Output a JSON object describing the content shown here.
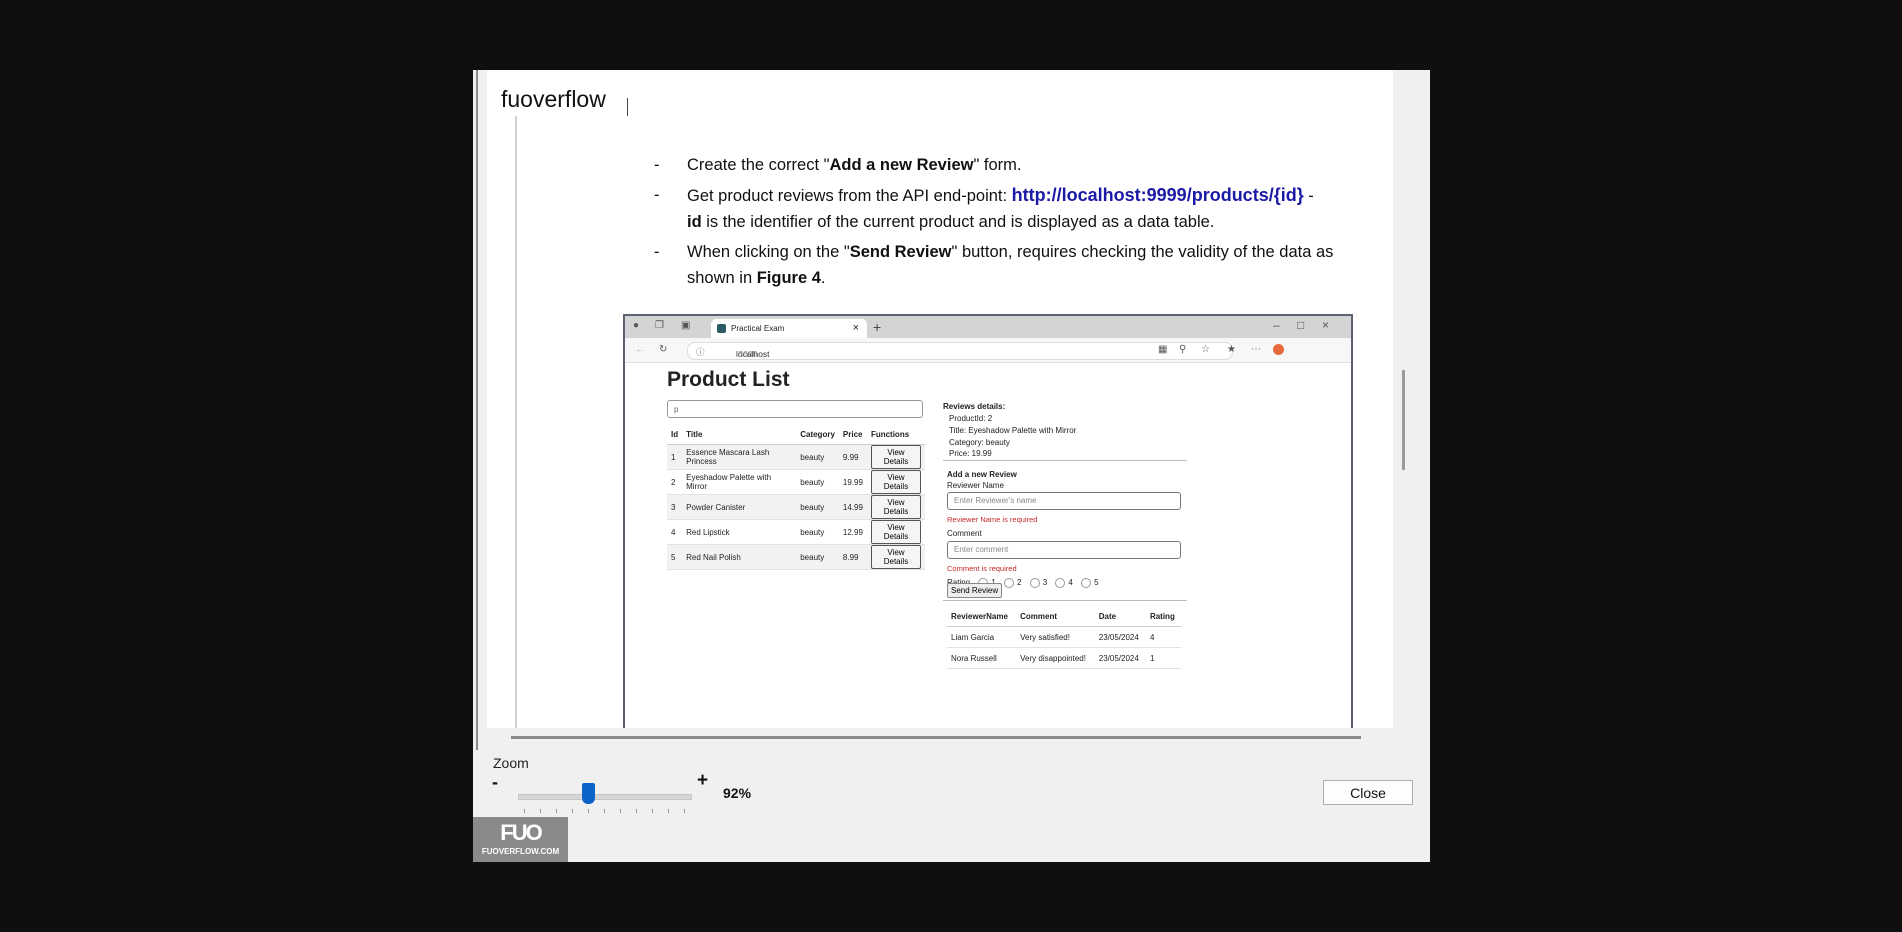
{
  "viewer": {
    "title": "fuoverflow",
    "zoom_label": "Zoom",
    "zoom_minus": "-",
    "zoom_plus": "+",
    "zoom_value": "92%",
    "zoom_level_percent": 92,
    "close_label": "Close",
    "logo_mark": "FUO",
    "logo_site": "FUOVERFLOW.COM"
  },
  "document": {
    "bullets": [
      {
        "dash": "-",
        "pre": "Create the correct \"",
        "bold": "Add a new Review",
        "post": "\" form."
      },
      {
        "dash": "-",
        "pre": "Get product reviews from the API end-point: ",
        "link": "http://localhost:9999/products/{id}",
        "dash2": " -",
        "bold2": "id",
        "post": " is the identifier of the current product and is displayed as a data table."
      },
      {
        "dash": "-",
        "pre": "When clicking on the \"",
        "bold": "Send Review",
        "mid": "\" button, requires checking the validity of the data as shown in ",
        "bold2": "Figure 4",
        "post": "."
      }
    ]
  },
  "figure": {
    "tab_title": "Practical Exam",
    "url_host": "localhost",
    "url_port": ":3000",
    "page_title": "Product List",
    "search_value": "p",
    "product_headers": [
      "Id",
      "Title",
      "Category",
      "Price",
      "Functions"
    ],
    "products": [
      {
        "id": "1",
        "title": "Essence Mascara Lash Princess",
        "category": "beauty",
        "price": "9.99",
        "action": "View Details"
      },
      {
        "id": "2",
        "title": "Eyeshadow Palette with Mirror",
        "category": "beauty",
        "price": "19.99",
        "action": "View Details"
      },
      {
        "id": "3",
        "title": "Powder Canister",
        "category": "beauty",
        "price": "14.99",
        "action": "View Details"
      },
      {
        "id": "4",
        "title": "Red Lipstick",
        "category": "beauty",
        "price": "12.99",
        "action": "View Details"
      },
      {
        "id": "5",
        "title": "Red Nail Polish",
        "category": "beauty",
        "price": "8.99",
        "action": "View Details"
      }
    ],
    "details": {
      "heading": "Reviews details:",
      "product_id": "ProductId: 2",
      "title": "Title: Eyeshadow Palette with Mirror",
      "category": "Category: beauty",
      "price": "Price: 19.99"
    },
    "form": {
      "heading": "Add a new Review",
      "name_label": "Reviewer Name",
      "name_placeholder": "Enter Reviewer's name",
      "name_error": "Reviewer Name is required",
      "comment_label": "Comment",
      "comment_placeholder": "Enter comment",
      "comment_error": "Comment is required",
      "rating_label": "Rating",
      "rating_options": [
        "1",
        "2",
        "3",
        "4",
        "5"
      ],
      "send_label": "Send Review"
    },
    "review_headers": [
      "ReviewerName",
      "Comment",
      "Date",
      "Rating"
    ],
    "reviews": [
      {
        "name": "Liam Garcia",
        "comment": "Very satisfied!",
        "date": "23/05/2024",
        "rating": "4"
      },
      {
        "name": "Nora Russell",
        "comment": "Very disappointed!",
        "date": "23/05/2024",
        "rating": "1"
      }
    ]
  }
}
